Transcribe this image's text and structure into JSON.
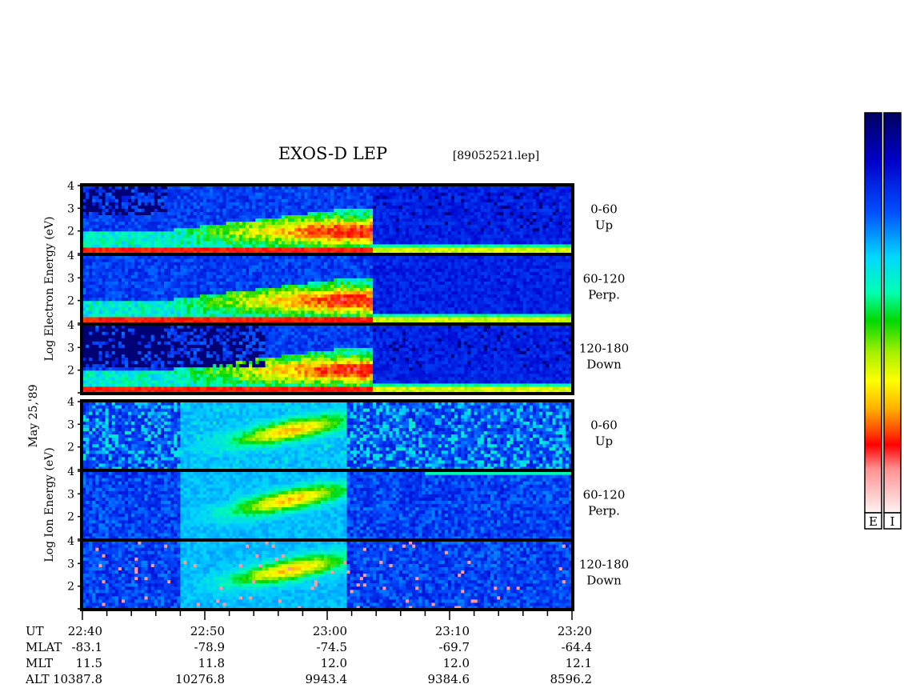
{
  "chart_data": {
    "type": "heatmap",
    "title": "EXOS-D LEP",
    "file_label": "[89052521.lep]",
    "date_label": "May 25,'89",
    "electron_ylabel": "Log   Electron   Energy (eV)",
    "ion_ylabel": "Log   Ion   Energy (eV)",
    "time_range": [
      "22:40",
      "23:20"
    ],
    "ylim": [
      1,
      4
    ],
    "panels": [
      {
        "species": "Electron",
        "angle": "0-60",
        "direction": "Up",
        "yticks": [
          "4",
          "3",
          "2"
        ]
      },
      {
        "species": "Electron",
        "angle": "60-120",
        "direction": "Perp.",
        "yticks": [
          "4",
          "3",
          "2"
        ]
      },
      {
        "species": "Electron",
        "angle": "120-180",
        "direction": "Down",
        "yticks": [
          "4",
          "3",
          "2"
        ]
      },
      {
        "species": "Ion",
        "angle": "0-60",
        "direction": "Up",
        "yticks": [
          "4",
          "3",
          "2"
        ]
      },
      {
        "species": "Ion",
        "angle": "60-120",
        "direction": "Perp.",
        "yticks": [
          "4",
          "3",
          "2"
        ]
      },
      {
        "species": "Ion",
        "angle": "120-180",
        "direction": "Down",
        "yticks": [
          "4",
          "3",
          "2"
        ]
      }
    ],
    "orbit_row_labels": [
      "UT",
      "MLAT",
      "MLT",
      "ALT"
    ],
    "orbit_columns": [
      {
        "ut": "22:40",
        "mlat": "-83.1",
        "mlt": "11.5",
        "alt": "10387.8"
      },
      {
        "ut": "22:50",
        "mlat": "-78.9",
        "mlt": "11.8",
        "alt": "10276.8"
      },
      {
        "ut": "23:00",
        "mlat": "-74.5",
        "mlt": "12.0",
        "alt": "9943.4"
      },
      {
        "ut": "23:10",
        "mlat": "-69.7",
        "mlt": "12.0",
        "alt": "9384.6"
      },
      {
        "ut": "23:20",
        "mlat": "-64.4",
        "mlt": "12.1",
        "alt": "8596.2"
      }
    ],
    "colorbars": [
      {
        "label": "E",
        "name": "electron-colorbar"
      },
      {
        "label": "I",
        "name": "ion-colorbar"
      }
    ],
    "colorscale": [
      "#00007a",
      "#0000c8",
      "#0050ff",
      "#00c8ff",
      "#00ffc0",
      "#00e000",
      "#b8f000",
      "#ffff00",
      "#ffb000",
      "#ff5000",
      "#ff0000",
      "#ff9090",
      "#ffe0e0"
    ]
  }
}
